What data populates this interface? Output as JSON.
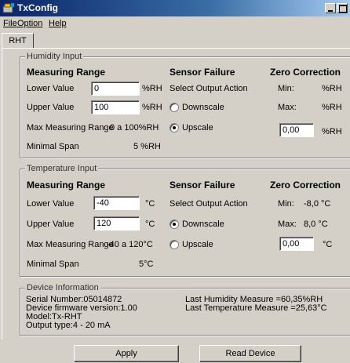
{
  "window": {
    "title": "TxConfig"
  },
  "menu": [
    "File",
    "Option",
    "Help"
  ],
  "tab": {
    "label": "RHT"
  },
  "humidity": {
    "group_title": "Humidity Input",
    "measuring_range_title": "Measuring Range",
    "lower_label": "Lower Value",
    "lower_value": "0",
    "lower_unit": "%RH",
    "upper_label": "Upper Value",
    "upper_value": "100",
    "upper_unit": "%RH",
    "max_range_label": "Max Measuring Range",
    "max_range_value": "0 a 100%RH",
    "min_span_label": "Minimal Span",
    "min_span_value": "5 %RH",
    "sensor_failure_title": "Sensor Failure",
    "select_output": "Select Output Action",
    "downscale": "Downscale",
    "upscale": "Upscale",
    "selected_action": "Upscale",
    "zero_title": "Zero Correction",
    "min_label": "Min:",
    "min_value": "%RH",
    "max_label": "Max:",
    "max_value": "%RH",
    "zero_value": "0,00",
    "zero_unit": "%RH"
  },
  "temperature": {
    "group_title": "Temperature Input",
    "measuring_range_title": "Measuring Range",
    "lower_label": "Lower Value",
    "lower_value": "-40",
    "lower_unit": "°C",
    "upper_label": "Upper Value",
    "upper_value": "120",
    "upper_unit": "°C",
    "max_range_label": "Max Measuring Range",
    "max_range_value": "-40 a 120°C",
    "min_span_label": "Minimal Span",
    "min_span_value": "5°C",
    "sensor_failure_title": "Sensor Failure",
    "select_output": "Select Output Action",
    "downscale": "Downscale",
    "upscale": "Upscale",
    "selected_action": "Downscale",
    "zero_title": "Zero Correction",
    "min_label": "Min:",
    "min_value": "-8,0 °C",
    "max_label": "Max:",
    "max_value": "8,0 °C",
    "zero_value": "0,00",
    "zero_unit": "°C"
  },
  "device": {
    "group_title": "Device Information",
    "serial": "Serial Number:05014872",
    "firmware": "Device firmware version:1.00",
    "model": "Model:Tx-RHT",
    "output_type": "Output type:4 - 20 mA",
    "last_humidity": "Last Humidity Measure =60,35%RH",
    "last_temperature": "Last Temperature Measure =25,63°C"
  },
  "buttons": {
    "apply": "Apply",
    "read_device": "Read Device"
  }
}
